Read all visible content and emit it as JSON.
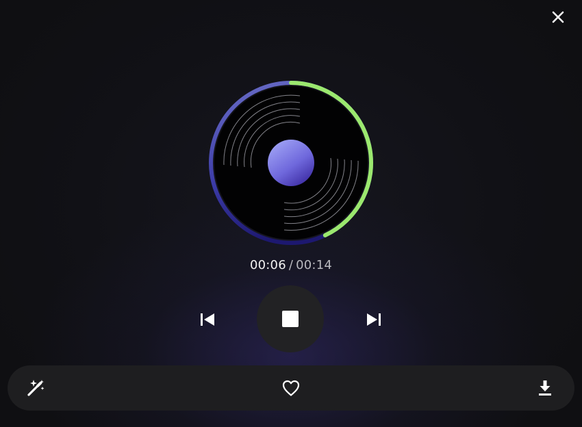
{
  "player": {
    "current_time": "00:06",
    "separator": "/",
    "total_time": "00:14",
    "progress_fraction": 0.43
  },
  "colors": {
    "progress": "#9be86e",
    "ring_track": "#5a5fc4",
    "label_light": "#8f8ff0",
    "label_dark": "#4134a8",
    "controls_bg": "#222224",
    "bottom_bar_bg": "#1e1e20"
  },
  "icons": {
    "close": "close-icon",
    "previous": "skip-previous-icon",
    "stop": "stop-icon",
    "next": "skip-next-icon",
    "magic": "magic-wand-icon",
    "like": "heart-icon",
    "download": "download-icon"
  }
}
